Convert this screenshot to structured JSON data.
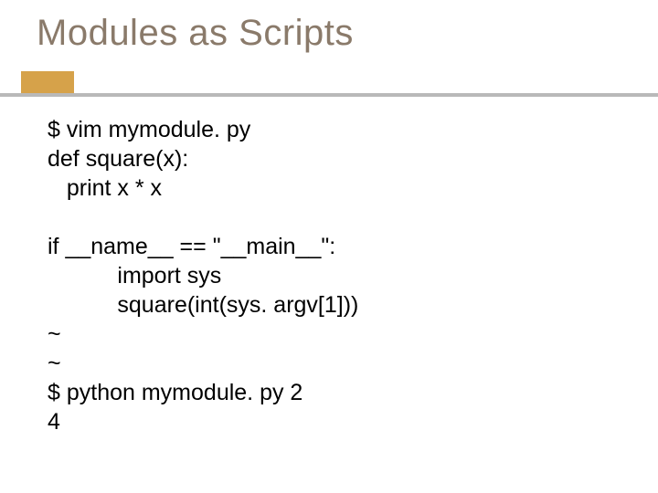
{
  "title": "Modules as Scripts",
  "code": {
    "l1": "$ vim mymodule. py",
    "l2": "def square(x):",
    "l3": "   print x * x",
    "l4": "if __name__ == \"__main__\":",
    "l5": "           import sys",
    "l6": "           square(int(sys. argv[1]))",
    "l7": "~",
    "l8": "~",
    "l9": "$ python mymodule. py 2",
    "l10": "4"
  }
}
